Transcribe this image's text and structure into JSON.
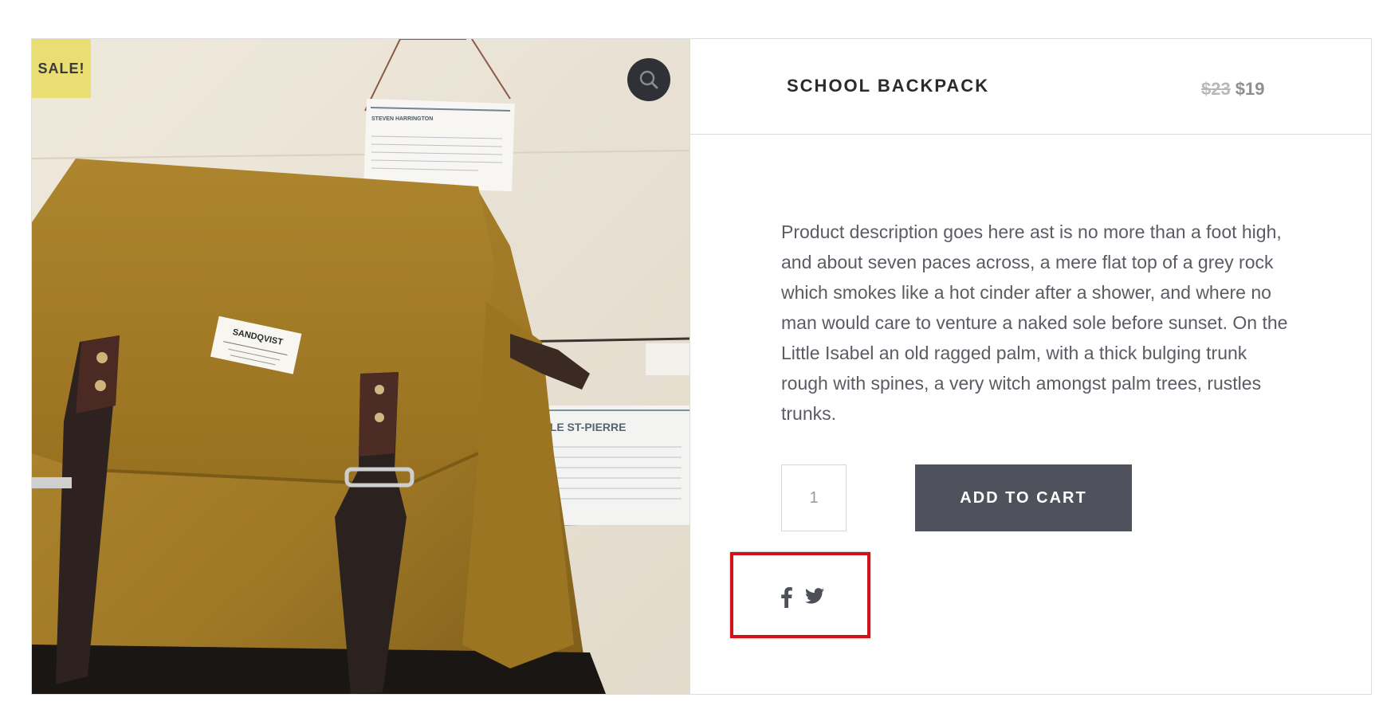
{
  "badge": {
    "sale_label": "SALE!"
  },
  "product": {
    "title": "SCHOOL BACKPACK",
    "price_old": "$23",
    "price_new": "$19",
    "description": "Product description goes here ast is no more than a foot high, and about seven paces across, a mere flat top of a grey rock which smokes like a hot cinder after a shower, and where no man would care to venture a naked sole before sunset. On the Little Isabel an old ragged palm, with a thick bulging trunk rough with spines, a very witch amongst palm trees, rustles trunks."
  },
  "cart": {
    "quantity": "1",
    "add_label": "ADD TO CART"
  },
  "image": {
    "brand_label": "SANDQVIST",
    "poster_top_heading": "STEVEN HARRINGTON",
    "poster_bottom_heading": "EILLE ST-PIERRE"
  },
  "share": {
    "icons": [
      "facebook-icon",
      "twitter-icon"
    ]
  },
  "colors": {
    "sale_badge": "#e8de74",
    "button": "#4f525d",
    "highlight": "#d0121b",
    "bag": "#a87f2a"
  }
}
